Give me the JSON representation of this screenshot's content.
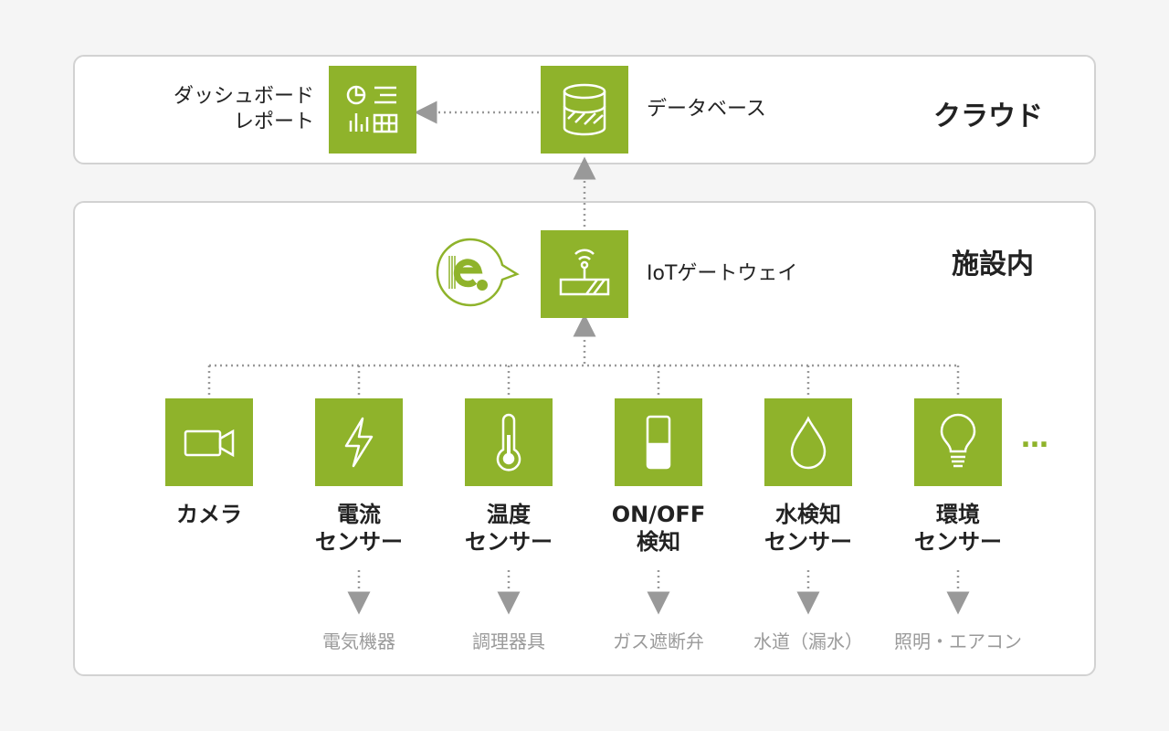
{
  "colors": {
    "accent": "#8fb32b",
    "panel_border": "#d2d2d2",
    "connector": "#999999",
    "target_text": "#9a9a9a"
  },
  "cloud": {
    "title": "クラウド",
    "dashboard": {
      "icon": "dashboard-icon",
      "label_line1": "ダッシュボード",
      "label_line2": "レポート"
    },
    "database": {
      "icon": "database-icon",
      "label": "データベース"
    }
  },
  "facility": {
    "title": "施設内",
    "gateway": {
      "icon": "router-icon",
      "label": "IoTゲートウェイ",
      "logo": "e-logo"
    },
    "sensors": [
      {
        "icon": "camera-icon",
        "line1": "カメラ",
        "line2": "",
        "target": ""
      },
      {
        "icon": "lightning-icon",
        "line1": "電流",
        "line2": "センサー",
        "target": "電気機器"
      },
      {
        "icon": "thermometer-icon",
        "line1": "温度",
        "line2": "センサー",
        "target": "調理器具"
      },
      {
        "icon": "switch-icon",
        "line1": "ON/OFF",
        "line2": "検知",
        "target": "ガス遮断弁"
      },
      {
        "icon": "water-drop-icon",
        "line1": "水検知",
        "line2": "センサー",
        "target": "水道（漏水）"
      },
      {
        "icon": "lightbulb-icon",
        "line1": "環境",
        "line2": "センサー",
        "target": "照明・エアコン"
      }
    ],
    "more": "…"
  }
}
